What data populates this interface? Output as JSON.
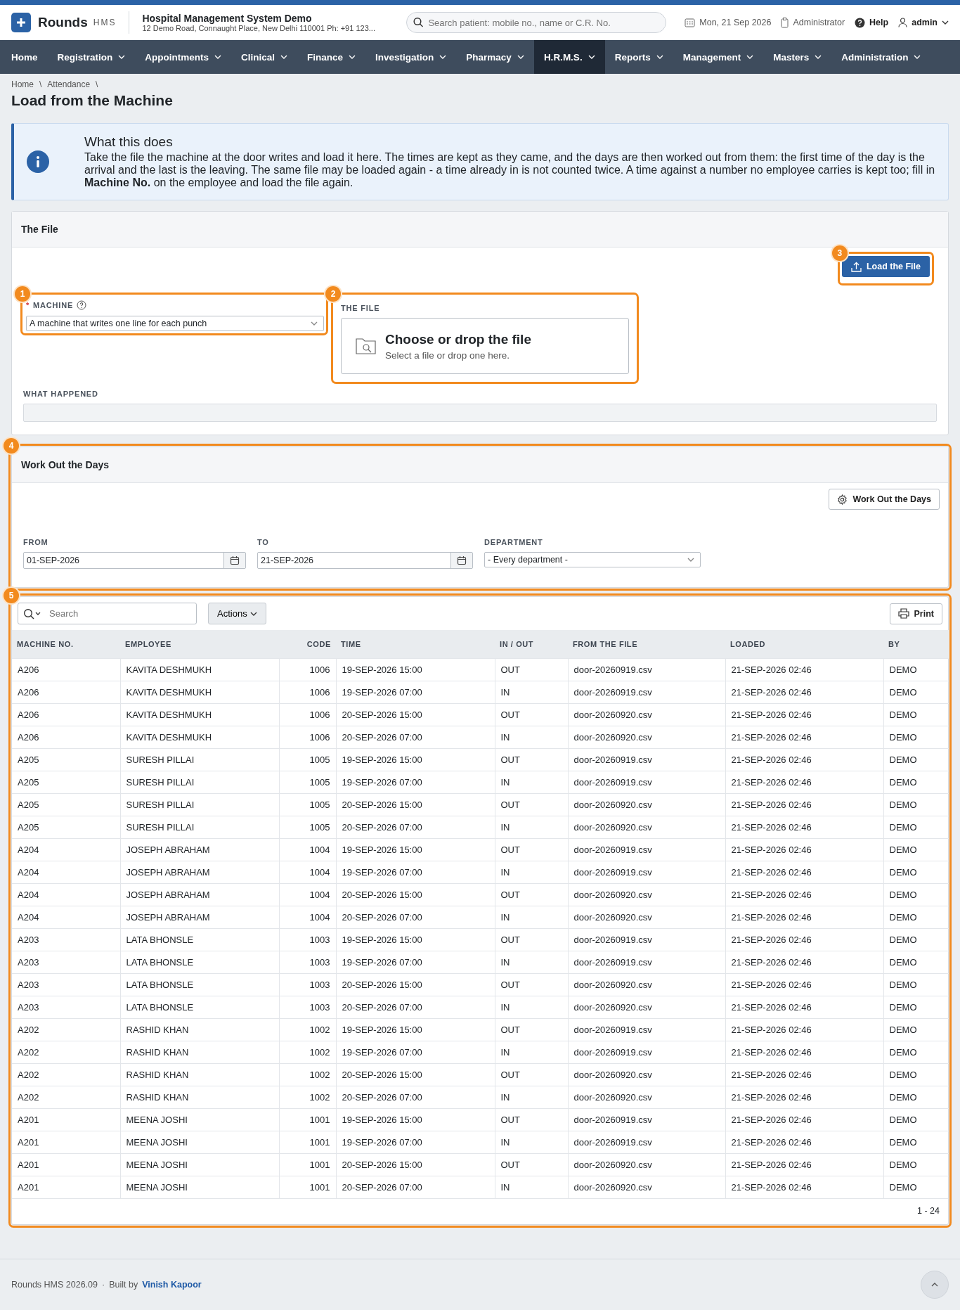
{
  "header": {
    "logo": "Rounds",
    "logo_suffix": "HMS",
    "org_name": "Hospital Management System Demo",
    "org_address": "12 Demo Road, Connaught Place, New Delhi 110001 Ph: +91 123...",
    "search_placeholder": "Search patient: mobile no., name or C.R. No.",
    "date": "Mon, 21 Sep 2026",
    "role": "Administrator",
    "help": "Help",
    "user": "admin"
  },
  "nav": [
    {
      "label": "Home",
      "menu": false,
      "selected": false
    },
    {
      "label": "Registration",
      "menu": true,
      "selected": false
    },
    {
      "label": "Appointments",
      "menu": true,
      "selected": false
    },
    {
      "label": "Clinical",
      "menu": true,
      "selected": false
    },
    {
      "label": "Finance",
      "menu": true,
      "selected": false
    },
    {
      "label": "Investigation",
      "menu": true,
      "selected": false
    },
    {
      "label": "Pharmacy",
      "menu": true,
      "selected": false
    },
    {
      "label": "H.R.M.S.",
      "menu": true,
      "selected": true
    },
    {
      "label": "Reports",
      "menu": true,
      "selected": false
    },
    {
      "label": "Management",
      "menu": true,
      "selected": false
    },
    {
      "label": "Masters",
      "menu": true,
      "selected": false
    },
    {
      "label": "Administration",
      "menu": true,
      "selected": false
    }
  ],
  "breadcrumb": {
    "items": [
      "Home",
      "Attendance"
    ],
    "separator": "\\"
  },
  "title": "Load from the Machine",
  "info": {
    "title": "What this does",
    "text": "Take the file the machine at the door writes and load it here. The times are kept as they came, and the days are then worked out from them: the first time of the day is the arrival and the last is the leaving. The same file may be loaded again - a time already in is not counted twice. A time against a number no employee carries is kept too; fill in **Machine No.** on the employee and load the file again."
  },
  "file_card": {
    "title": "The File",
    "load_button": {
      "label": "Load the File",
      "callout": "3"
    },
    "machine": {
      "label": "MACHINE",
      "required": true,
      "required_mark": "*",
      "value": "A machine that writes one line for each punch",
      "callout": "1"
    },
    "file": {
      "label": "THE FILE",
      "title": "Choose or drop the file",
      "hint": "Select a file or drop one here.",
      "callout": "2"
    },
    "result": {
      "label": "WHAT HAPPENED"
    }
  },
  "days_card": {
    "title": "Work Out the Days",
    "callout": "4",
    "button": "Work Out the Days",
    "from": {
      "label": "FROM",
      "value": "01-SEP-2026"
    },
    "to": {
      "label": "TO",
      "value": "21-SEP-2026"
    },
    "department": {
      "label": "DEPARTMENT",
      "value": "- Every department -"
    }
  },
  "table_card": {
    "callout": "5",
    "search_placeholder": "Search",
    "actions": "Actions",
    "print": "Print",
    "pager": "1 - 24",
    "columns": [
      "MACHINE NO.",
      "EMPLOYEE",
      "CODE",
      "TIME",
      "IN / OUT",
      "FROM THE FILE",
      "LOADED",
      "BY"
    ],
    "rows": [
      [
        "A206",
        "KAVITA DESHMUKH",
        "1006",
        "19-SEP-2026 15:00",
        "OUT",
        "door-20260919.csv",
        "21-SEP-2026 02:46",
        "DEMO"
      ],
      [
        "A206",
        "KAVITA DESHMUKH",
        "1006",
        "19-SEP-2026 07:00",
        "IN",
        "door-20260919.csv",
        "21-SEP-2026 02:46",
        "DEMO"
      ],
      [
        "A206",
        "KAVITA DESHMUKH",
        "1006",
        "20-SEP-2026 15:00",
        "OUT",
        "door-20260920.csv",
        "21-SEP-2026 02:46",
        "DEMO"
      ],
      [
        "A206",
        "KAVITA DESHMUKH",
        "1006",
        "20-SEP-2026 07:00",
        "IN",
        "door-20260920.csv",
        "21-SEP-2026 02:46",
        "DEMO"
      ],
      [
        "A205",
        "SURESH PILLAI",
        "1005",
        "19-SEP-2026 15:00",
        "OUT",
        "door-20260919.csv",
        "21-SEP-2026 02:46",
        "DEMO"
      ],
      [
        "A205",
        "SURESH PILLAI",
        "1005",
        "19-SEP-2026 07:00",
        "IN",
        "door-20260919.csv",
        "21-SEP-2026 02:46",
        "DEMO"
      ],
      [
        "A205",
        "SURESH PILLAI",
        "1005",
        "20-SEP-2026 15:00",
        "OUT",
        "door-20260920.csv",
        "21-SEP-2026 02:46",
        "DEMO"
      ],
      [
        "A205",
        "SURESH PILLAI",
        "1005",
        "20-SEP-2026 07:00",
        "IN",
        "door-20260920.csv",
        "21-SEP-2026 02:46",
        "DEMO"
      ],
      [
        "A204",
        "JOSEPH ABRAHAM",
        "1004",
        "19-SEP-2026 15:00",
        "OUT",
        "door-20260919.csv",
        "21-SEP-2026 02:46",
        "DEMO"
      ],
      [
        "A204",
        "JOSEPH ABRAHAM",
        "1004",
        "19-SEP-2026 07:00",
        "IN",
        "door-20260919.csv",
        "21-SEP-2026 02:46",
        "DEMO"
      ],
      [
        "A204",
        "JOSEPH ABRAHAM",
        "1004",
        "20-SEP-2026 15:00",
        "OUT",
        "door-20260920.csv",
        "21-SEP-2026 02:46",
        "DEMO"
      ],
      [
        "A204",
        "JOSEPH ABRAHAM",
        "1004",
        "20-SEP-2026 07:00",
        "IN",
        "door-20260920.csv",
        "21-SEP-2026 02:46",
        "DEMO"
      ],
      [
        "A203",
        "LATA BHONSLE",
        "1003",
        "19-SEP-2026 15:00",
        "OUT",
        "door-20260919.csv",
        "21-SEP-2026 02:46",
        "DEMO"
      ],
      [
        "A203",
        "LATA BHONSLE",
        "1003",
        "19-SEP-2026 07:00",
        "IN",
        "door-20260919.csv",
        "21-SEP-2026 02:46",
        "DEMO"
      ],
      [
        "A203",
        "LATA BHONSLE",
        "1003",
        "20-SEP-2026 15:00",
        "OUT",
        "door-20260920.csv",
        "21-SEP-2026 02:46",
        "DEMO"
      ],
      [
        "A203",
        "LATA BHONSLE",
        "1003",
        "20-SEP-2026 07:00",
        "IN",
        "door-20260920.csv",
        "21-SEP-2026 02:46",
        "DEMO"
      ],
      [
        "A202",
        "RASHID KHAN",
        "1002",
        "19-SEP-2026 15:00",
        "OUT",
        "door-20260919.csv",
        "21-SEP-2026 02:46",
        "DEMO"
      ],
      [
        "A202",
        "RASHID KHAN",
        "1002",
        "19-SEP-2026 07:00",
        "IN",
        "door-20260919.csv",
        "21-SEP-2026 02:46",
        "DEMO"
      ],
      [
        "A202",
        "RASHID KHAN",
        "1002",
        "20-SEP-2026 15:00",
        "OUT",
        "door-20260920.csv",
        "21-SEP-2026 02:46",
        "DEMO"
      ],
      [
        "A202",
        "RASHID KHAN",
        "1002",
        "20-SEP-2026 07:00",
        "IN",
        "door-20260920.csv",
        "21-SEP-2026 02:46",
        "DEMO"
      ],
      [
        "A201",
        "MEENA JOSHI",
        "1001",
        "19-SEP-2026 15:00",
        "OUT",
        "door-20260919.csv",
        "21-SEP-2026 02:46",
        "DEMO"
      ],
      [
        "A201",
        "MEENA JOSHI",
        "1001",
        "19-SEP-2026 07:00",
        "IN",
        "door-20260919.csv",
        "21-SEP-2026 02:46",
        "DEMO"
      ],
      [
        "A201",
        "MEENA JOSHI",
        "1001",
        "20-SEP-2026 15:00",
        "OUT",
        "door-20260920.csv",
        "21-SEP-2026 02:46",
        "DEMO"
      ],
      [
        "A201",
        "MEENA JOSHI",
        "1001",
        "20-SEP-2026 07:00",
        "IN",
        "door-20260920.csv",
        "21-SEP-2026 02:46",
        "DEMO"
      ]
    ]
  },
  "footer": {
    "version": "Rounds HMS 2026.09",
    "dot": "·",
    "built_by": "Built by",
    "author": "Vinish Kapoor"
  }
}
